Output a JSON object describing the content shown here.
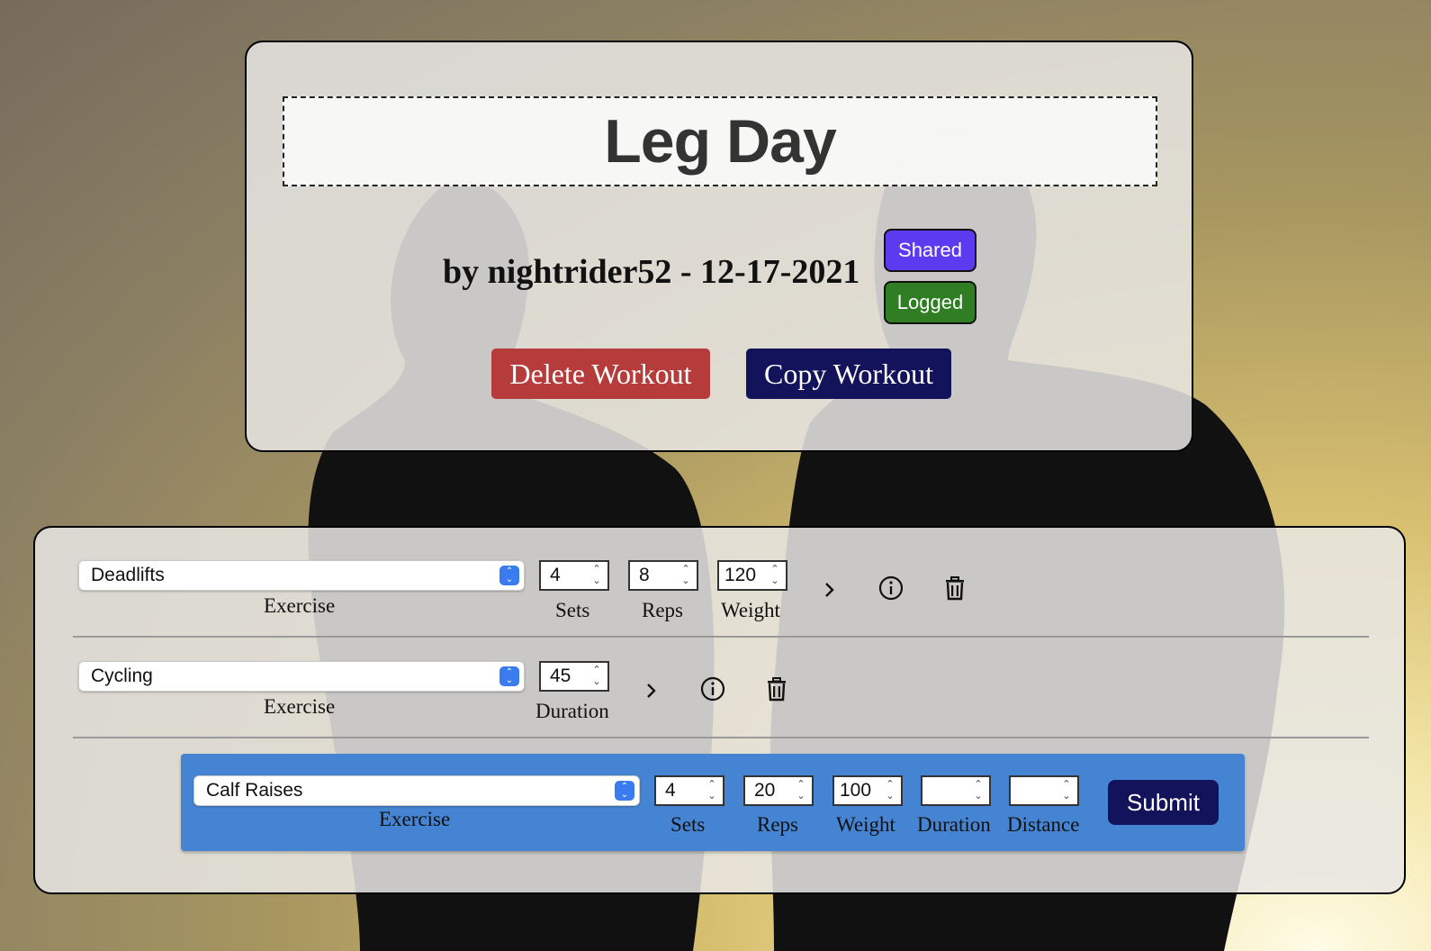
{
  "workout": {
    "title": "Leg Day",
    "byline": "by nightrider52 - 12-17-2021",
    "badges": {
      "shared": "Shared",
      "logged": "Logged"
    },
    "delete_label": "Delete Workout",
    "copy_label": "Copy Workout"
  },
  "exercises": [
    {
      "name": "Deadlifts",
      "exercise_label": "Exercise",
      "fields": [
        {
          "label": "Sets",
          "value": "4"
        },
        {
          "label": "Reps",
          "value": "8"
        },
        {
          "label": "Weight",
          "value": "120"
        }
      ]
    },
    {
      "name": "Cycling",
      "exercise_label": "Exercise",
      "fields": [
        {
          "label": "Duration",
          "value": "45"
        }
      ]
    }
  ],
  "new_exercise": {
    "name": "Calf Raises",
    "exercise_label": "Exercise",
    "fields": [
      {
        "label": "Sets",
        "value": "4"
      },
      {
        "label": "Reps",
        "value": "20"
      },
      {
        "label": "Weight",
        "value": "100"
      },
      {
        "label": "Duration",
        "value": ""
      },
      {
        "label": "Distance",
        "value": ""
      }
    ],
    "submit_label": "Submit"
  },
  "colors": {
    "shared": "#5b3af0",
    "logged": "#2f7e23",
    "delete": "#b53c3a",
    "copy": "#13135c",
    "new_row": "#4584d3",
    "select_accent": "#3a7bf0"
  },
  "icons": {
    "expand": "chevron-right-icon",
    "info": "info-icon",
    "delete": "trash-icon"
  }
}
